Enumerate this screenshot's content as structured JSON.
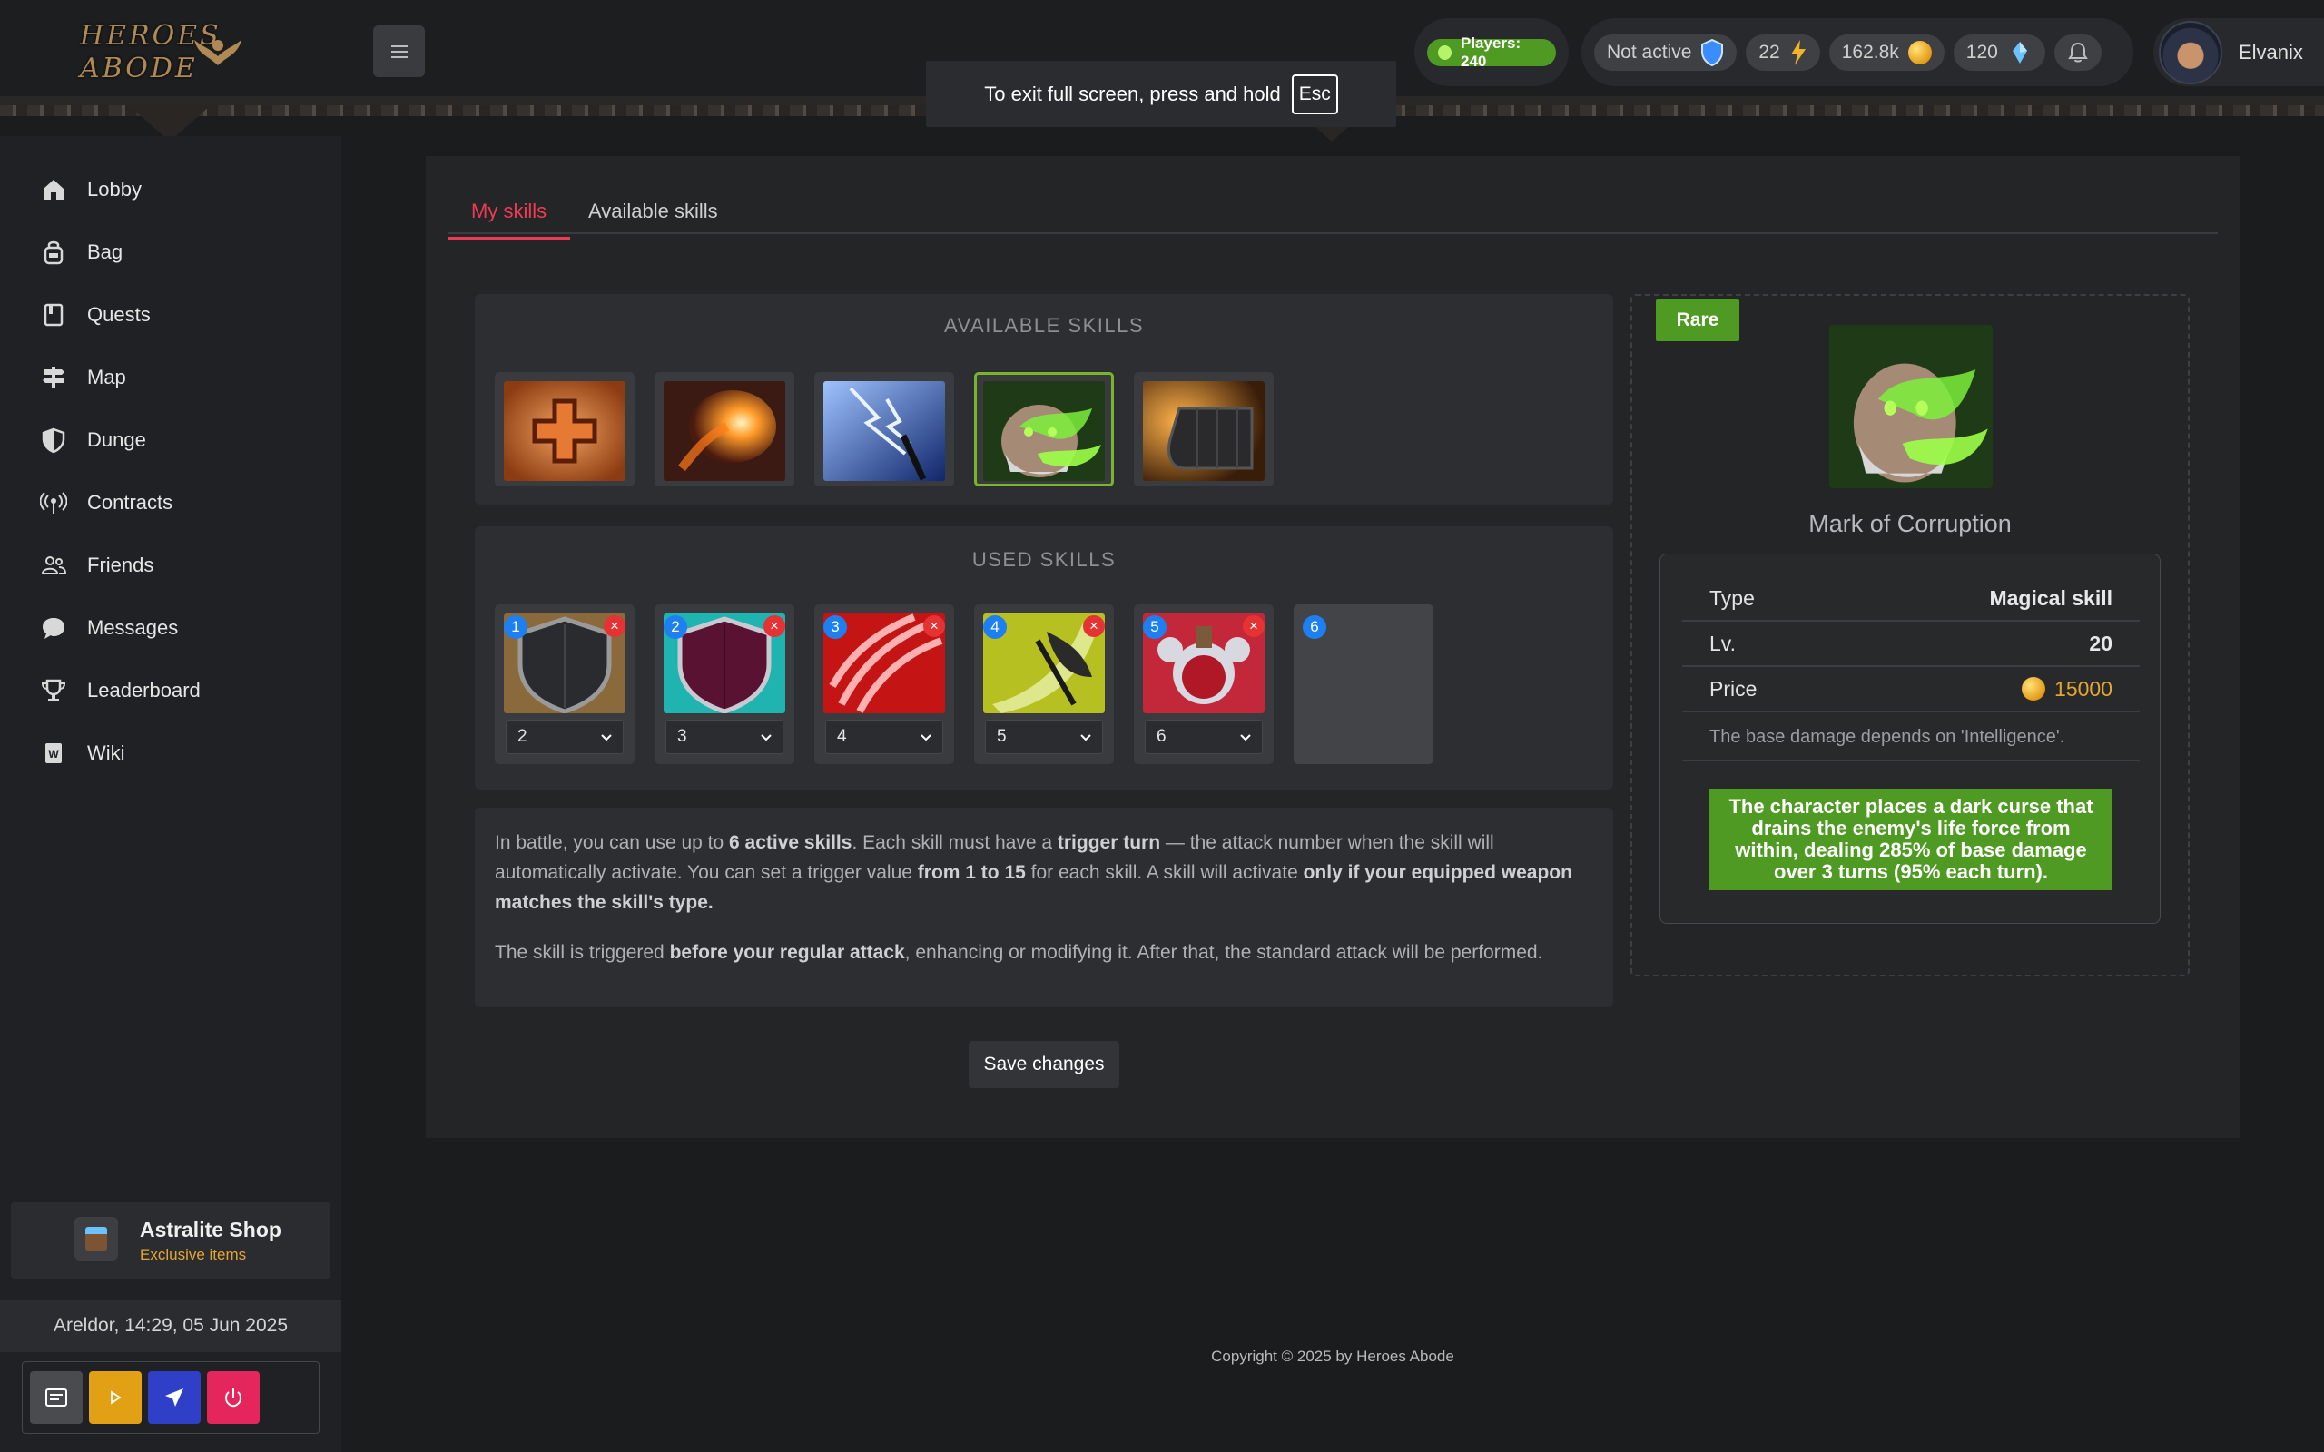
{
  "header": {
    "logo_text": "HEROES ABODE",
    "fullscreen_notice": "To exit full screen, press and hold",
    "fullscreen_key": "Esc",
    "players": "Players: 240",
    "status": "Not active",
    "energy": "22",
    "gold": "162.8k",
    "astralite": "120",
    "username": "Elvanix"
  },
  "sidebar": {
    "items": [
      {
        "label": "Lobby",
        "icon": "home-icon"
      },
      {
        "label": "Bag",
        "icon": "bag-icon"
      },
      {
        "label": "Quests",
        "icon": "book-icon"
      },
      {
        "label": "Map",
        "icon": "signpost-icon"
      },
      {
        "label": "Dunge",
        "icon": "shield-icon"
      },
      {
        "label": "Contracts",
        "icon": "broadcast-icon"
      },
      {
        "label": "Friends",
        "icon": "people-icon"
      },
      {
        "label": "Messages",
        "icon": "chat-icon"
      },
      {
        "label": "Leaderboard",
        "icon": "trophy-icon"
      },
      {
        "label": "Wiki",
        "icon": "wiki-icon"
      }
    ],
    "shop_title": "Astralite Shop",
    "shop_subtitle": "Exclusive items",
    "clock": "Areldor, 14:29, 05 Jun 2025"
  },
  "tabs": {
    "my": "My skills",
    "available": "Available skills"
  },
  "available_skills": {
    "title": "AVAILABLE SKILLS",
    "items": [
      "healing-skill",
      "fireball-skill",
      "lightning-skill",
      "corruption-skill",
      "gauntlet-skill"
    ],
    "selected_index": 3
  },
  "used_skills": {
    "title": "USED SKILLS",
    "slots": [
      {
        "number": "1",
        "trigger": "2",
        "skill": "dark-shield-skill"
      },
      {
        "number": "2",
        "trigger": "3",
        "skill": "crimson-shield-skill"
      },
      {
        "number": "3",
        "trigger": "4",
        "skill": "claw-slash-skill"
      },
      {
        "number": "4",
        "trigger": "5",
        "skill": "axe-strike-skill"
      },
      {
        "number": "5",
        "trigger": "6",
        "skill": "potion-skill"
      },
      {
        "number": "6",
        "trigger": "",
        "skill": ""
      }
    ],
    "remove_symbol": "×"
  },
  "info": {
    "p1_a": "In battle, you can use up to ",
    "p1_b": "6 active skills",
    "p1_c": ". Each skill must have a ",
    "p1_d": "trigger turn",
    "p1_e": " — the attack number when the skill will automatically activate. You can set a trigger value ",
    "p1_f": "from 1 to 15",
    "p1_g": " for each skill. A skill will activate ",
    "p1_h": "only if your equipped weapon matches the skill's type.",
    "p2_a": "The skill is triggered ",
    "p2_b": "before your regular attack",
    "p2_c": ", enhancing or modifying it. After that, the standard attack will be performed."
  },
  "save_label": "Save changes",
  "detail": {
    "rarity": "Rare",
    "name": "Mark of Corruption",
    "type_label": "Type",
    "type_value": "Magical skill",
    "level_label": "Lv.",
    "level_value": "20",
    "price_label": "Price",
    "price_value": "15000",
    "note": "The base damage depends on 'Intelligence'.",
    "description": "The character places a dark curse that drains the enemy's life force from within, dealing 285% of base damage over 3 turns (95% each turn)."
  },
  "colors": {
    "accent": "#ee3b54",
    "rare_green": "#4e9a22",
    "gold": "#e4a632",
    "badge_blue": "#1e7ff0",
    "remove_red": "#e63232"
  },
  "footer": {
    "copyright": "Copyright © 2025 by Heroes Abode"
  }
}
